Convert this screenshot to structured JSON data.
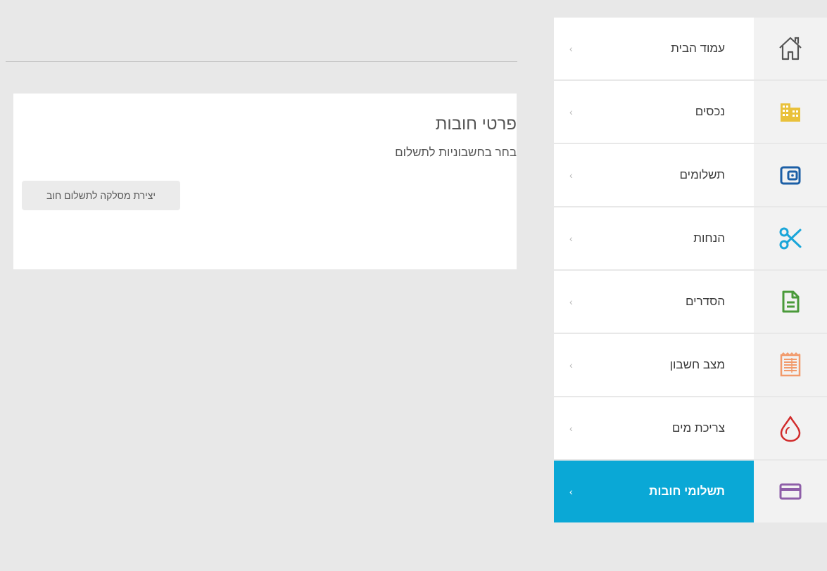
{
  "sidebar": {
    "items": [
      {
        "label": "עמוד הבית",
        "icon": "home-icon",
        "color": "#555555",
        "active": false
      },
      {
        "label": "נכסים",
        "icon": "buildings-icon",
        "color": "#e9c13b",
        "active": false
      },
      {
        "label": "תשלומים",
        "icon": "wallet-icon",
        "color": "#1c5fa6",
        "active": false
      },
      {
        "label": "הנחות",
        "icon": "scissors-icon",
        "color": "#1aa6d9",
        "active": false
      },
      {
        "label": "הסדרים",
        "icon": "document-icon",
        "color": "#4a9a3a",
        "active": false
      },
      {
        "label": "מצב חשבון",
        "icon": "statement-icon",
        "color": "#f29a6b",
        "active": false
      },
      {
        "label": "צריכת מים",
        "icon": "water-drop-icon",
        "color": "#d12b2b",
        "active": false
      },
      {
        "label": "תשלומי חובות",
        "icon": "credit-card-icon",
        "color": "#8e5ea8",
        "active": true
      }
    ],
    "chevron": "‹"
  },
  "card": {
    "title": "פרטי חובות",
    "subtitle": "בחר בחשבוניות לתשלום",
    "button_label": "יצירת מסלקה לתשלום חוב"
  },
  "colors": {
    "active_bg": "#0aa8d6",
    "page_bg": "#e8e8e8"
  }
}
